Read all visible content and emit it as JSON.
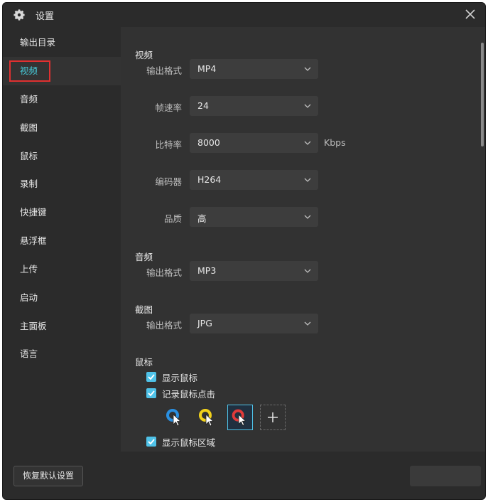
{
  "window": {
    "title": "设置"
  },
  "sidebar": {
    "items": [
      {
        "label": "输出目录",
        "active": false
      },
      {
        "label": "视频",
        "active": true
      },
      {
        "label": "音频",
        "active": false
      },
      {
        "label": "截图",
        "active": false
      },
      {
        "label": "鼠标",
        "active": false
      },
      {
        "label": "录制",
        "active": false
      },
      {
        "label": "快捷键",
        "active": false
      },
      {
        "label": "悬浮框",
        "active": false
      },
      {
        "label": "上传",
        "active": false
      },
      {
        "label": "启动",
        "active": false
      },
      {
        "label": "主面板",
        "active": false
      },
      {
        "label": "语言",
        "active": false
      }
    ]
  },
  "video": {
    "title": "视频",
    "format": {
      "label": "输出格式",
      "value": "MP4"
    },
    "fps": {
      "label": "帧速率",
      "value": "24"
    },
    "bitrate": {
      "label": "比特率",
      "value": "8000",
      "unit": "Kbps"
    },
    "encoder": {
      "label": "编码器",
      "value": "H264"
    },
    "quality": {
      "label": "品质",
      "value": "高"
    }
  },
  "audio": {
    "title": "音频",
    "format": {
      "label": "输出格式",
      "value": "MP3"
    }
  },
  "screenshot": {
    "title": "截图",
    "format": {
      "label": "输出格式",
      "value": "JPG"
    }
  },
  "mouse": {
    "title": "鼠标",
    "show_cursor": {
      "label": "显示鼠标",
      "checked": true
    },
    "record_clicks": {
      "label": "记录鼠标点击",
      "checked": true
    },
    "cursor_styles": [
      {
        "color": "#2a8fe0",
        "selected": false
      },
      {
        "color": "#f2d21b",
        "selected": false
      },
      {
        "color": "#e03a3a",
        "selected": true
      }
    ],
    "show_region": {
      "label": "显示鼠标区域",
      "checked": true
    }
  },
  "footer": {
    "reset_label": "恢复默认设置"
  },
  "colors": {
    "accent": "#4fc2e8",
    "active_nav_text": "#46c8d6",
    "highlight_border": "#e03030"
  }
}
